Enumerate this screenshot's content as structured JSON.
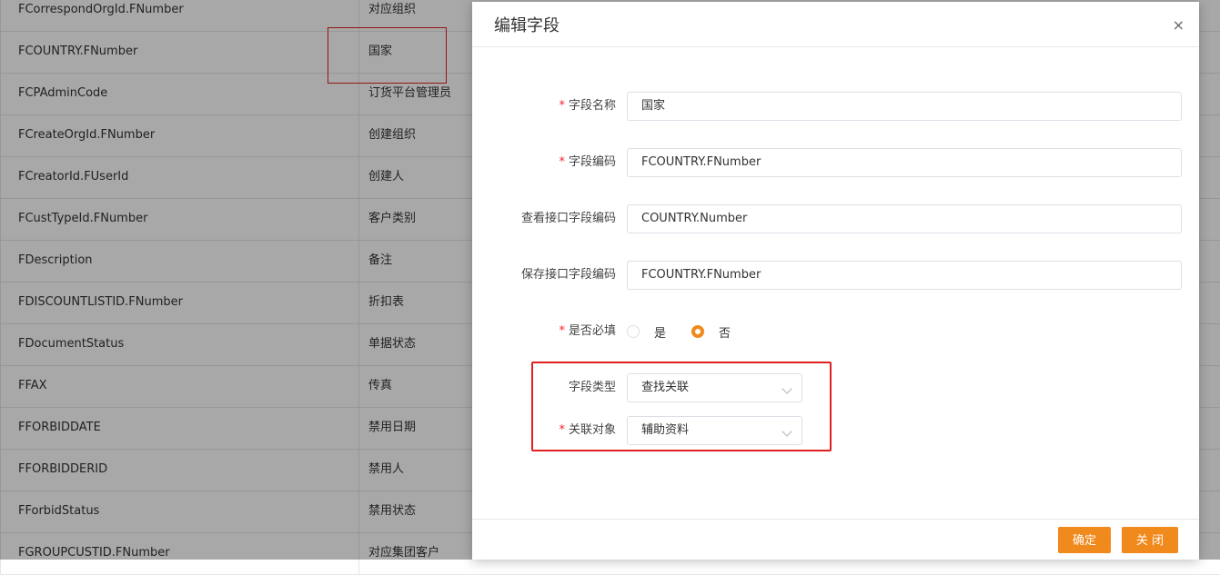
{
  "background_table": {
    "rows": [
      {
        "code": "FCorrespondOrgId.FNumber",
        "name": "对应组织"
      },
      {
        "code": "FCOUNTRY.FNumber",
        "name": "国家"
      },
      {
        "code": "FCPAdminCode",
        "name": "订货平台管理员"
      },
      {
        "code": "FCreateOrgId.FNumber",
        "name": "创建组织"
      },
      {
        "code": "FCreatorId.FUserId",
        "name": "创建人"
      },
      {
        "code": "FCustTypeId.FNumber",
        "name": "客户类别"
      },
      {
        "code": "FDescription",
        "name": "备注"
      },
      {
        "code": "FDISCOUNTLISTID.FNumber",
        "name": "折扣表"
      },
      {
        "code": "FDocumentStatus",
        "name": "单据状态"
      },
      {
        "code": "FFAX",
        "name": "传真"
      },
      {
        "code": "FFORBIDDATE",
        "name": "禁用日期"
      },
      {
        "code": "FFORBIDDERID",
        "name": "禁用人"
      },
      {
        "code": "FForbidStatus",
        "name": "禁用状态"
      },
      {
        "code": "FGROUPCUSTID.FNumber",
        "name": "对应集团客户"
      }
    ]
  },
  "dialog": {
    "title": "编辑字段",
    "close_glyph": "×",
    "required_mark": "*",
    "fields": {
      "field_name": {
        "label": "字段名称",
        "value": "国家"
      },
      "field_code": {
        "label": "字段编码",
        "value": "FCOUNTRY.FNumber"
      },
      "view_api_code": {
        "label": "查看接口字段编码",
        "value": "COUNTRY.Number"
      },
      "save_api_code": {
        "label": "保存接口字段编码",
        "value": "FCOUNTRY.FNumber"
      },
      "required": {
        "label": "是否必填",
        "options": [
          "是",
          "否"
        ],
        "selected": "否"
      },
      "field_type": {
        "label": "字段类型",
        "value": "查找关联"
      },
      "related_object": {
        "label": "关联对象",
        "value": "辅助资料"
      }
    },
    "buttons": {
      "ok": "确定",
      "close": "关 闭"
    }
  },
  "colors": {
    "accent": "#f08a1c",
    "highlight": "#e02020",
    "required": "#f5222d"
  }
}
